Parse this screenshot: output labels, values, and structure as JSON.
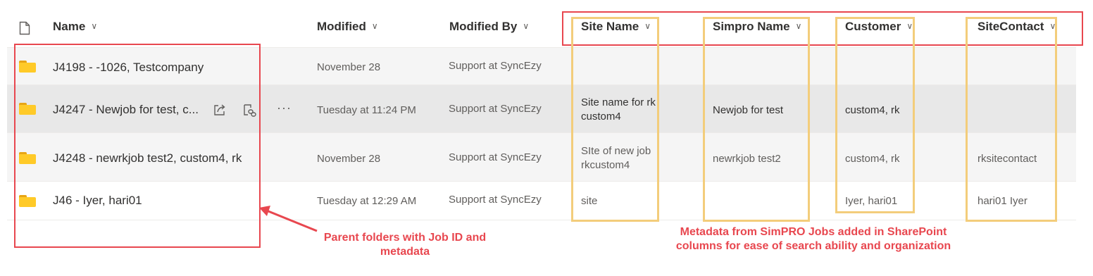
{
  "columns": {
    "name": "Name",
    "modified": "Modified",
    "modified_by": "Modified By",
    "site_name": "Site Name",
    "simpro_name": "Simpro Name",
    "customer": "Customer",
    "site_contact": "SiteContact"
  },
  "rows": [
    {
      "name": "J4198 - -1026, Testcompany",
      "modified": "November 28",
      "modified_by": "Support at SyncEzy",
      "site_name_1": "",
      "site_name_2": "",
      "simpro_name": "",
      "customer": "",
      "site_contact": ""
    },
    {
      "name": "J4247 - Newjob for test, c...",
      "modified": "Tuesday at 11:24 PM",
      "modified_by": "Support at SyncEzy",
      "site_name_1": "Site name for rk",
      "site_name_2": "custom4",
      "simpro_name": "Newjob for test",
      "customer": "custom4, rk",
      "site_contact": ""
    },
    {
      "name": "J4248 - newrkjob test2, custom4, rk",
      "modified": "November 28",
      "modified_by": "Support at SyncEzy",
      "site_name_1": "SIte of new job",
      "site_name_2": "rkcustom4",
      "simpro_name": "newrkjob test2",
      "customer": "custom4, rk",
      "site_contact": "rksitecontact"
    },
    {
      "name": "J46 - Iyer, hari01",
      "modified": "Tuesday at 12:29 AM",
      "modified_by": "Support at SyncEzy",
      "site_name_1": "site",
      "site_name_2": "",
      "simpro_name": "",
      "customer": "Iyer, hari01",
      "site_contact": "hari01 Iyer"
    }
  ],
  "annotations": {
    "left_line1": "Parent folders with Job ID and",
    "left_line2": "metadata",
    "right_line1": "Metadata from SimPRO Jobs added in SharePoint",
    "right_line2": "columns for ease of search ability and organization"
  },
  "icons": {
    "file_type": "file-icon",
    "folder": "folder-icon",
    "share": "share-icon",
    "copy_link": "copy-link-icon",
    "more": "more-actions-icon",
    "sort": "chevron-down-icon"
  },
  "colors": {
    "annotation_red": "#e8474f",
    "highlight_yellow": "#f3cd7b",
    "folder_yellow": "#ffca28",
    "row_alt": "#f5f5f5",
    "row_selected": "#e8e8e8"
  }
}
